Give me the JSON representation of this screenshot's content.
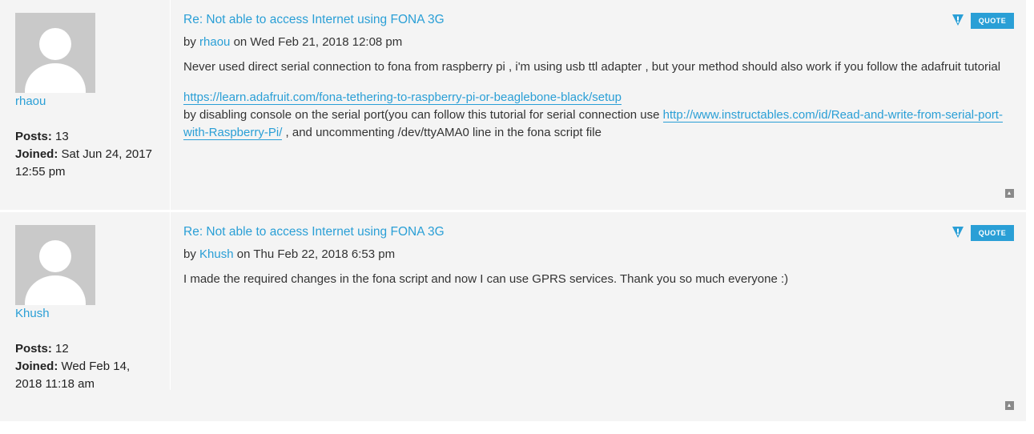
{
  "posts": [
    {
      "username": "rhaou",
      "posts_label": "Posts:",
      "posts_count": "13",
      "joined_label": "Joined:",
      "joined_value": "Sat Jun 24, 2017 12:55 pm",
      "title": "Re: Not able to access Internet using FONA 3G",
      "by": "by",
      "author": "rhaou",
      "on_date": "on Wed Feb 21, 2018 12:08 pm",
      "p1": "Never used direct serial connection to fona from raspberry pi , i'm using usb ttl adapter , but your method should also work if you follow the adafruit tutorial",
      "link1": "https://learn.adafruit.com/fona-tethering-to-raspberry-pi-or-beaglebone-black/setup",
      "p2a": "by disabling console on the serial port(you can follow this tutorial for serial connection use ",
      "link2": "http://www.instructables.com/id/Read-and-write-from-serial-port-with-Raspberry-Pi/",
      "p2b": " , and uncommenting /dev/ttyAMA0 line in the fona script file",
      "quote": "QUOTE"
    },
    {
      "username": "Khush",
      "posts_label": "Posts:",
      "posts_count": "12",
      "joined_label": "Joined:",
      "joined_value": "Wed Feb 14, 2018 11:18 am",
      "title": "Re: Not able to access Internet using FONA 3G",
      "by": "by",
      "author": "Khush",
      "on_date": "on Thu Feb 22, 2018 6:53 pm",
      "p1": "I made the required changes in the fona script and now I can use GPRS services. Thank you so much everyone :)",
      "quote": "QUOTE"
    }
  ],
  "colors": {
    "link": "#2a9fd6",
    "post_bg": "#f4f4f4",
    "avatar_bg": "#c9c9c9"
  },
  "icons": {
    "report": "report-warning-icon",
    "top": "back-to-top-icon"
  }
}
